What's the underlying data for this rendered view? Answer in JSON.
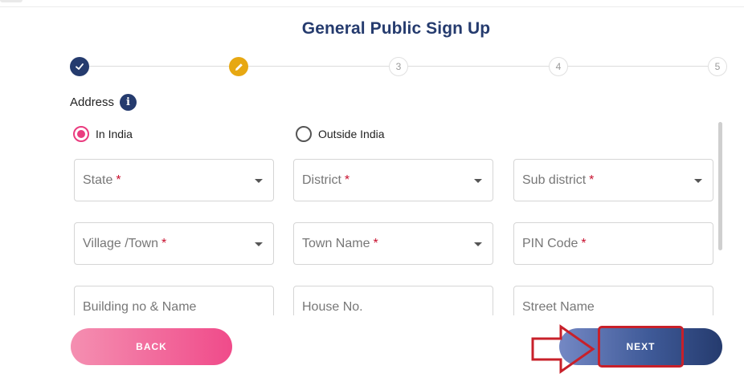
{
  "page": {
    "title": "General Public Sign Up"
  },
  "stepper": {
    "steps": [
      {
        "state": "done",
        "icon": "checkmark-icon",
        "label": ""
      },
      {
        "state": "editing",
        "icon": "pencil-icon",
        "label": ""
      },
      {
        "state": "pending",
        "label": "3"
      },
      {
        "state": "pending",
        "label": "4"
      },
      {
        "state": "pending",
        "label": "5"
      }
    ]
  },
  "section": {
    "label": "Address",
    "info_icon": "i"
  },
  "location": {
    "options": [
      {
        "label": "In India",
        "selected": true
      },
      {
        "label": "Outside India",
        "selected": false
      }
    ]
  },
  "fields": {
    "state": {
      "label": "State",
      "required_mark": "*"
    },
    "district": {
      "label": "District",
      "required_mark": "*"
    },
    "sub_district": {
      "label": "Sub district",
      "required_mark": "*"
    },
    "village_town": {
      "label": "Village /Town",
      "required_mark": "*"
    },
    "town_name": {
      "label": "Town Name",
      "required_mark": "*"
    },
    "pin_code": {
      "label": "PIN Code",
      "required_mark": "*"
    },
    "building": {
      "label": "Building no & Name"
    },
    "house_no": {
      "label": "House No."
    },
    "street_name": {
      "label": "Street Name"
    }
  },
  "buttons": {
    "back": "BACK",
    "next": "NEXT"
  },
  "colors": {
    "primary": "#253b6e",
    "accent_pink": "#ea3c7f",
    "edit_step": "#e7a812",
    "required": "#c8102e",
    "annotation": "#c8202a"
  }
}
